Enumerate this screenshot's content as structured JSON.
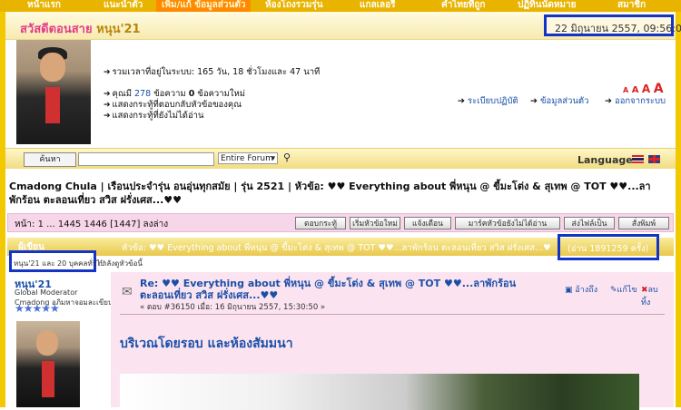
{
  "nav": {
    "items": [
      "หน้าแรก",
      "แนะนำตัว",
      "เพิ่ม/แก้ ข้อมูลส่วนตัว",
      "ห้องโถงรวมรุ่น",
      "แกลเลอรี่",
      "คำไทยที่ถูก",
      "ปฏิทินนัดหมาย",
      "สมาชิก"
    ],
    "active_index": 2
  },
  "greeting": {
    "prefix": "สวัสดีตอนสาย",
    "username": "หนุน'21",
    "datetime": "22 มิถุนายน 2557, 09:56:03"
  },
  "user_panel": {
    "online_time": "รวมเวลาที่อยู่ในระบบ: 165 วัน, 18 ชั่วโมงและ 47 นาที",
    "messages_label": "คุณมี",
    "messages_count": "278",
    "messages_mid": "ข้อความ",
    "new_count": "0",
    "messages_suffix": "ข้อความใหม่",
    "link_replies": "แสดงกระทู้ที่ตอบกลับหัวข้อของคุณ",
    "link_unread": "แสดงกระทู้ที่ยังไม่ได้อ่าน",
    "rules": "ระเบียบปฏิบัติ",
    "profile": "ข้อมูลส่วนตัว",
    "logout": "ออกจากระบบ",
    "font_sizes": "A A A A"
  },
  "search": {
    "button": "ค้นหา",
    "scope": "Entire Forum",
    "languages": "Languages"
  },
  "breadcrumb": "Cmadong Chula  |  เรือนประจำรุ่น อนอุ่นทุกสมัย  |  รุ่น 2521  |  หัวข้อ: ♥♥ Everything about พี่หนุน @ ขี้มะโต่ง & สุเทพ @ TOT ♥♥...ลาพักร้อน ตะลอนเที่ยว สวิส ฝรั่งเศส...♥♥",
  "pager": {
    "text": "หน้า: 1 ... 1445 1446 [1447]   ลงล่าง",
    "buttons": [
      "ตอบกระทู้",
      "เริ่มหัวข้อใหม่",
      "แจ้งเตือน",
      "มาร์คหัวข้อยังไม่ได้อ่าน",
      "ส่งไฟล์เป็น",
      "สั่งพิมพ์"
    ]
  },
  "topic": {
    "author_label": "ผู้เขียน",
    "subject": "หัวข้อ: ♥♥ Everything about พี่หนุน @ ขี้มะโต่ง & สุเทพ @ TOT ♥♥...ลาพักร้อน ตะลอนเที่ยว สวิส ฝรั่งเศส...♥",
    "views": "(อ่าน 1891259 ครั้ง)",
    "viewers": "หนุน'21 และ 20 บุคคลทั่วไป",
    "viewers_suffix": "กำลังดูหัวข้อนี้"
  },
  "post": {
    "author": "หนุน'21",
    "role": "Global Moderator",
    "role2": "Cmadong อภิมหาจอมละเขียน",
    "stars": "★★★★★",
    "title": "Re: ♥♥ Everything about พี่หนุน @ ขี้มะโต่ง & สุเทพ @ TOT ♥♥...ลาพักร้อน ตะลอนเที่ยว สวิส ฝรั่งเศส...♥♥",
    "meta": "« ตอบ #36150 เมื่อ: 16 มิถุนายน 2557, 15:30:50 »",
    "quote": "อ้างถึง",
    "edit": "แก้ไข",
    "delete": "ลบ",
    "delete2": "ทิ้ง",
    "content": "บริเวณโดยรอบ และห้องสัมมนา"
  },
  "colors": {
    "accent_box": "#1434c8",
    "nav_bg": "#e9b400",
    "post_bg": "#fbe4f0"
  }
}
